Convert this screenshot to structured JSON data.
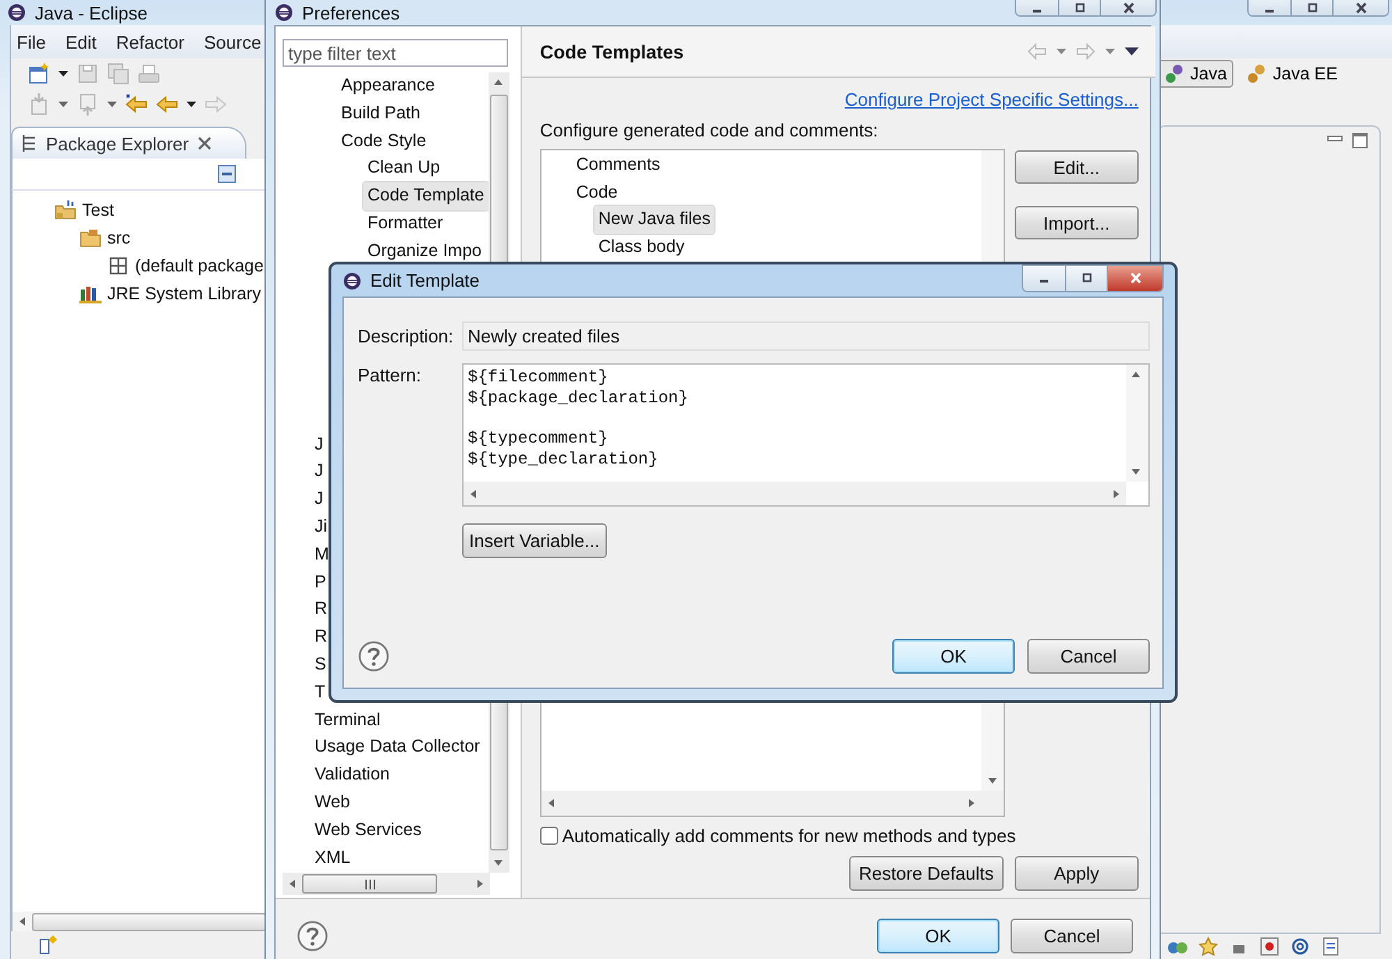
{
  "eclipse": {
    "title": "Java - Eclipse",
    "menu": [
      "File",
      "Edit",
      "Refactor",
      "Source"
    ],
    "package_explorer": {
      "title": "Package Explorer",
      "tree": [
        {
          "label": "Test",
          "kind": "project",
          "children": [
            {
              "label": "src",
              "kind": "folder",
              "children": [
                {
                  "label": "(default package",
                  "kind": "package"
                }
              ]
            },
            {
              "label": "JRE System Library",
              "kind": "library"
            }
          ]
        }
      ]
    },
    "perspectives": [
      {
        "label": "Java",
        "selected": true
      },
      {
        "label": "Java EE",
        "selected": false
      }
    ]
  },
  "preferences": {
    "title": "Preferences",
    "filter": {
      "placeholder": "type filter text"
    },
    "tree": {
      "scrolled_parent_children": [
        {
          "label": "Appearance",
          "selected": false
        },
        {
          "label": "Build Path",
          "selected": false
        },
        {
          "label": "Code Style",
          "selected": false,
          "children": [
            {
              "label": "Clean Up",
              "selected": false
            },
            {
              "label": "Code Template",
              "selected": true
            },
            {
              "label": "Formatter",
              "selected": false
            },
            {
              "label": "Organize Impo",
              "selected": false
            }
          ]
        }
      ],
      "items": [
        {
          "label": "J",
          "selected": false
        },
        {
          "label": "J",
          "selected": false
        },
        {
          "label": "J",
          "selected": false
        },
        {
          "label": "Ji",
          "selected": false
        },
        {
          "label": "M",
          "selected": false
        },
        {
          "label": "P",
          "selected": false
        },
        {
          "label": "R",
          "selected": false
        },
        {
          "label": "R",
          "selected": false
        },
        {
          "label": "S",
          "selected": false
        },
        {
          "label": "T",
          "selected": false
        },
        {
          "label": "Terminal",
          "selected": false
        },
        {
          "label": "Usage Data Collector",
          "selected": false
        },
        {
          "label": "Validation",
          "selected": false
        },
        {
          "label": "Web",
          "selected": false
        },
        {
          "label": "Web Services",
          "selected": false
        },
        {
          "label": "XML",
          "selected": false
        }
      ]
    },
    "page": {
      "title": "Code Templates",
      "link": "Configure Project Specific Settings...",
      "description": "Configure generated code and comments:",
      "templates": [
        {
          "label": "Comments",
          "selected": false
        },
        {
          "label": "Code",
          "selected": false,
          "children": [
            {
              "label": "New Java files",
              "selected": true
            },
            {
              "label": "Class body",
              "selected": false
            }
          ]
        }
      ],
      "side_buttons": [
        "Edit...",
        "Import..."
      ],
      "auto_comments": {
        "label": "Automatically add comments for new methods and types",
        "checked": false
      },
      "buttons": [
        "Restore Defaults",
        "Apply"
      ]
    },
    "buttons": [
      {
        "label": "OK",
        "default": true
      },
      {
        "label": "Cancel",
        "default": false
      }
    ]
  },
  "edit_template": {
    "title": "Edit Template",
    "description": {
      "label": "Description:",
      "value": "Newly created files"
    },
    "pattern": {
      "label": "Pattern:",
      "value": "${filecomment}\n${package_declaration}\n\n${typecomment}\n${type_declaration}"
    },
    "insert_button": "Insert Variable...",
    "buttons": [
      {
        "label": "OK",
        "default": true
      },
      {
        "label": "Cancel",
        "default": false
      }
    ]
  }
}
